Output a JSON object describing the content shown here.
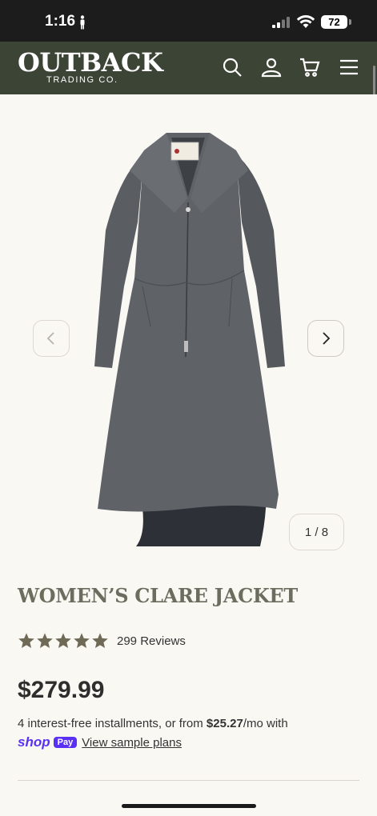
{
  "status_bar": {
    "time": "1:16",
    "battery": "72"
  },
  "header": {
    "logo": "OUTBACK",
    "logo_sub": "TRADING CO.",
    "icons": [
      "search-icon",
      "account-icon",
      "cart-icon",
      "menu-icon"
    ],
    "bg_color": "#3c4435"
  },
  "gallery": {
    "counter": "1 / 8",
    "current": 1,
    "total": 8
  },
  "product": {
    "title": "WOMEN’S CLARE JACKET",
    "rating": 5,
    "reviews": "299 Reviews",
    "price": "$279.99",
    "installments_prefix": "4 interest-free installments, or from ",
    "installments_amount": "$25.27",
    "installments_suffix": "/mo with",
    "shop_word": "shop",
    "pay_badge": "Pay",
    "sample_link": "View sample plans"
  },
  "colors": {
    "title": "#6b6e5e",
    "star": "#6f6a55",
    "shoppay": "#5a31f4"
  }
}
